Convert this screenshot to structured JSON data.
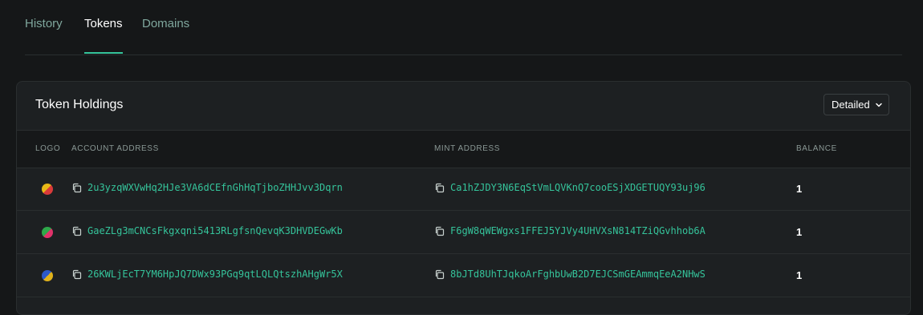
{
  "tabs": [
    {
      "label": "History"
    },
    {
      "label": "Tokens"
    },
    {
      "label": "Domains"
    }
  ],
  "active_tab": "Tokens",
  "card": {
    "title": "Token Holdings",
    "view_select": "Detailed"
  },
  "table": {
    "headers": {
      "logo": "LOGO",
      "account": "ACCOUNT ADDRESS",
      "mint": "MINT ADDRESS",
      "balance": "BALANCE"
    },
    "rows": [
      {
        "logo_colors": [
          "#e8b817",
          "#d93a3a"
        ],
        "account": "2u3yzqWXVwHq2HJe3VA6dCEfnGhHqTjboZHHJvv3Dqrn",
        "mint": "Ca1hZJDY3N6EqStVmLQVKnQ7cooESjXDGETUQY93uj96",
        "balance": "1"
      },
      {
        "logo_colors": [
          "#2ea84a",
          "#e0326a"
        ],
        "account": "GaeZLg3mCNCsFkgxqni5413RLgfsnQevqK3DHVDEGwKb",
        "mint": "F6gW8qWEWgxs1FFEJ5YJVy4UHVXsN814TZiQGvhhob6A",
        "balance": "1"
      },
      {
        "logo_colors": [
          "#2c59c9",
          "#e0b21b"
        ],
        "account": "26KWLjEcT7YM6HpJQ7DWx93PGq9qtLQLQtszhAHgWr5X",
        "mint": "8bJTd8UhTJqkoArFghbUwB2D7EJCSmGEAmmqEeA2NHwS",
        "balance": "1"
      }
    ]
  },
  "colors": {
    "accent": "#35c49b",
    "background": "#151718",
    "card": "#1d2022"
  }
}
